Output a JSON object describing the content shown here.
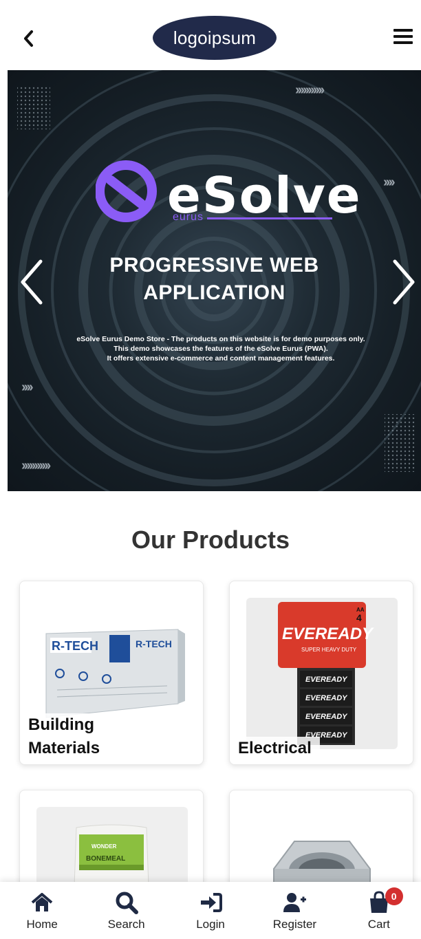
{
  "header": {
    "logo_text": "logoipsum",
    "back_icon": "chevron-left-icon",
    "menu_icon": "hamburger-menu-icon"
  },
  "hero": {
    "brand_name": "eSolve",
    "brand_sub": "eurus",
    "title_line1": "PROGRESSIVE WEB",
    "title_line2": "APPLICATION",
    "desc_line1": "eSolve Eurus Demo Store - The products on this website is for demo purposes only.",
    "desc_line2": "This demo showcases the features of the eSolve Eurus (PWA).",
    "desc_line3": "It offers extensive e-commerce and content management features.",
    "prev_icon": "chevron-left-icon",
    "next_icon": "chevron-right-icon",
    "accent_color": "#8b5cf6"
  },
  "products": {
    "title": "Our Products",
    "items": [
      {
        "label_line1": "Building",
        "label_line2": "Materials",
        "image": "r-tech-insulation-board"
      },
      {
        "label_line1": "Electrical",
        "label_line2": "",
        "image": "eveready-batteries-pack"
      },
      {
        "label_line1": "",
        "label_line2": "",
        "image": "bonemeal-fertilizer-bag"
      },
      {
        "label_line1": "",
        "label_line2": "",
        "image": "hex-nut"
      }
    ]
  },
  "bottom_nav": {
    "items": [
      {
        "label": "Home",
        "icon": "home-icon"
      },
      {
        "label": "Search",
        "icon": "search-icon"
      },
      {
        "label": "Login",
        "icon": "login-icon"
      },
      {
        "label": "Register",
        "icon": "user-plus-icon"
      },
      {
        "label": "Cart",
        "icon": "shopping-bag-icon"
      }
    ],
    "cart_count": "0"
  }
}
